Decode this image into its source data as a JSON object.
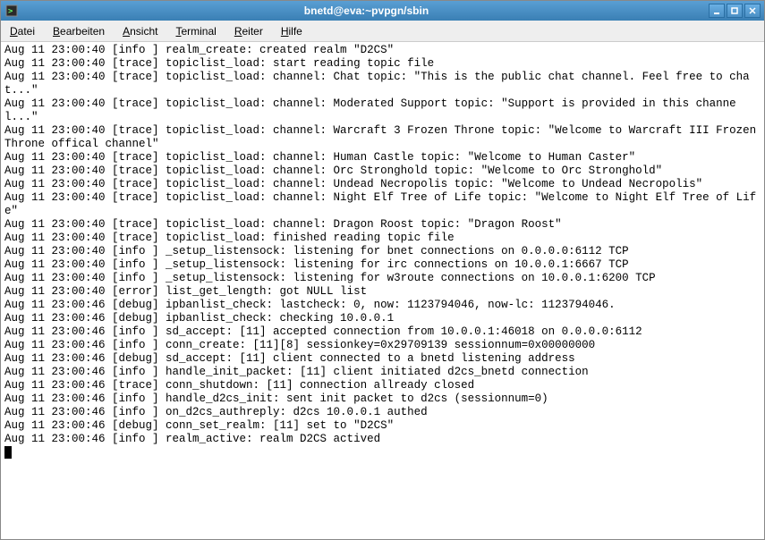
{
  "window": {
    "title": "bnetd@eva:~pvpgn/sbin"
  },
  "menubar": {
    "items": [
      {
        "label": "Datei",
        "mnemonic": "D"
      },
      {
        "label": "Bearbeiten",
        "mnemonic": "B"
      },
      {
        "label": "Ansicht",
        "mnemonic": "A"
      },
      {
        "label": "Terminal",
        "mnemonic": "T"
      },
      {
        "label": "Reiter",
        "mnemonic": "R"
      },
      {
        "label": "Hilfe",
        "mnemonic": "H"
      }
    ]
  },
  "terminal": {
    "lines": [
      "Aug 11 23:00:40 [info ] realm_create: created realm \"D2CS\"",
      "Aug 11 23:00:40 [trace] topiclist_load: start reading topic file",
      "Aug 11 23:00:40 [trace] topiclist_load: channel: Chat topic: \"This is the public chat channel. Feel free to chat...\"",
      "Aug 11 23:00:40 [trace] topiclist_load: channel: Moderated Support topic: \"Support is provided in this channel...\"",
      "Aug 11 23:00:40 [trace] topiclist_load: channel: Warcraft 3 Frozen Throne topic: \"Welcome to Warcraft III Frozen Throne offical channel\"",
      "Aug 11 23:00:40 [trace] topiclist_load: channel: Human Castle topic: \"Welcome to Human Caster\"",
      "Aug 11 23:00:40 [trace] topiclist_load: channel: Orc Stronghold topic: \"Welcome to Orc Stronghold\"",
      "Aug 11 23:00:40 [trace] topiclist_load: channel: Undead Necropolis topic: \"Welcome to Undead Necropolis\"",
      "Aug 11 23:00:40 [trace] topiclist_load: channel: Night Elf Tree of Life topic: \"Welcome to Night Elf Tree of Life\"",
      "Aug 11 23:00:40 [trace] topiclist_load: channel: Dragon Roost topic: \"Dragon Roost\"",
      "Aug 11 23:00:40 [trace] topiclist_load: finished reading topic file",
      "Aug 11 23:00:40 [info ] _setup_listensock: listening for bnet connections on 0.0.0.0:6112 TCP",
      "Aug 11 23:00:40 [info ] _setup_listensock: listening for irc connections on 10.0.0.1:6667 TCP",
      "Aug 11 23:00:40 [info ] _setup_listensock: listening for w3route connections on 10.0.0.1:6200 TCP",
      "Aug 11 23:00:40 [error] list_get_length: got NULL list",
      "Aug 11 23:00:46 [debug] ipbanlist_check: lastcheck: 0, now: 1123794046, now-lc: 1123794046.",
      "Aug 11 23:00:46 [debug] ipbanlist_check: checking 10.0.0.1",
      "Aug 11 23:00:46 [info ] sd_accept: [11] accepted connection from 10.0.0.1:46018 on 0.0.0.0:6112",
      "Aug 11 23:00:46 [info ] conn_create: [11][8] sessionkey=0x29709139 sessionnum=0x00000000",
      "Aug 11 23:00:46 [debug] sd_accept: [11] client connected to a bnetd listening address",
      "Aug 11 23:00:46 [info ] handle_init_packet: [11] client initiated d2cs_bnetd connection",
      "Aug 11 23:00:46 [trace] conn_shutdown: [11] connection allready closed",
      "Aug 11 23:00:46 [info ] handle_d2cs_init: sent init packet to d2cs (sessionnum=0)",
      "Aug 11 23:00:46 [info ] on_d2cs_authreply: d2cs 10.0.0.1 authed",
      "Aug 11 23:00:46 [debug] conn_set_realm: [11] set to \"D2CS\"",
      "Aug 11 23:00:46 [info ] realm_active: realm D2CS actived"
    ]
  }
}
